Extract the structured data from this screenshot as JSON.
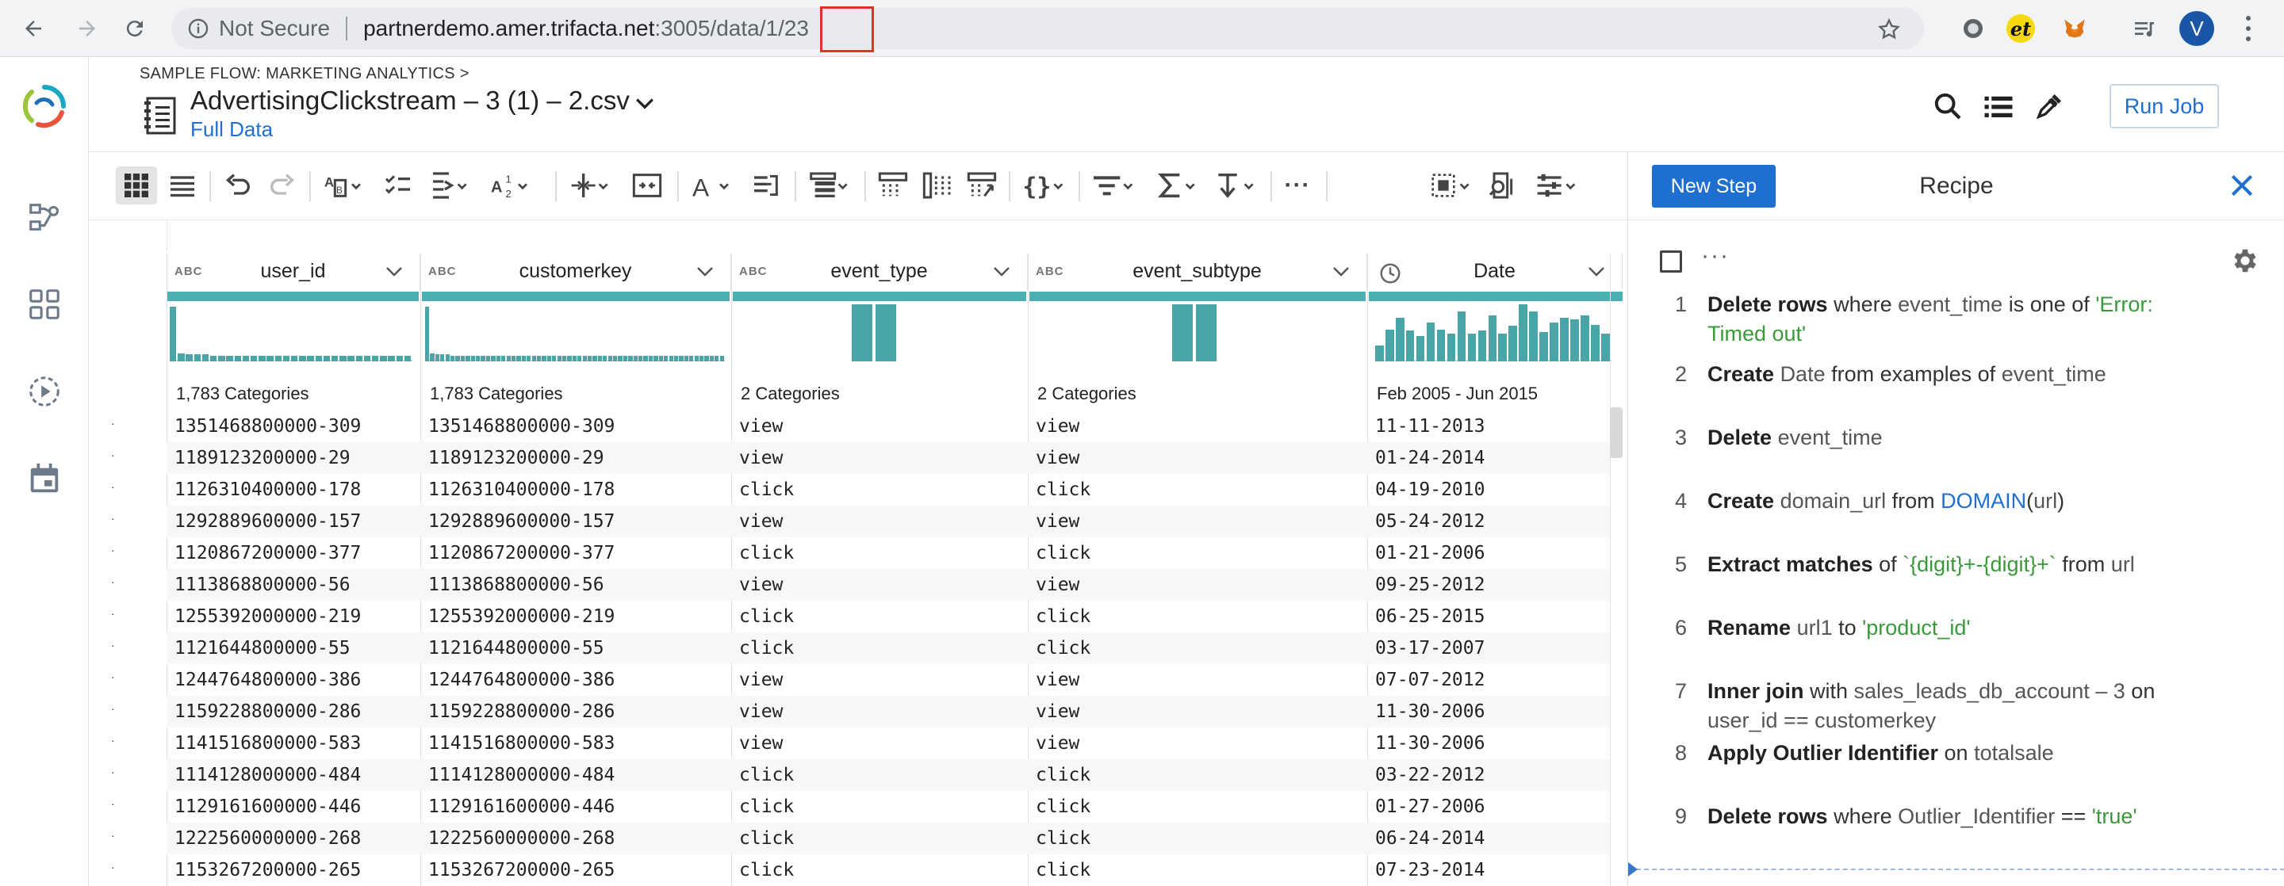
{
  "browser": {
    "not_secure": "Not Secure",
    "url_host": "partnerdemo.amer.trifacta.net",
    "url_rest": ":3005/data/1/",
    "url_highlight": "23",
    "avatar_letter": "V",
    "ext_letters": "et"
  },
  "header": {
    "breadcrumb": "SAMPLE FLOW: MARKETING ANALYTICS >",
    "title": "AdvertisingClickstream – 3 (1) – 2.csv",
    "subtitle": "Full Data",
    "run_job": "Run Job"
  },
  "grid": {
    "columns": [
      {
        "type": "ABC",
        "name": "user_id",
        "summary": "1,783 Categories"
      },
      {
        "type": "ABC",
        "name": "customerkey",
        "summary": "1,783 Categories"
      },
      {
        "type": "ABC",
        "name": "event_type",
        "summary": "2 Categories"
      },
      {
        "type": "ABC",
        "name": "event_subtype",
        "summary": "2 Categories"
      },
      {
        "type": "clock-icon",
        "name": "Date",
        "summary": "Feb 2005 - Jun 2015"
      }
    ],
    "histograms": {
      "user_id": [
        48,
        7,
        6,
        6,
        6,
        5,
        5,
        5,
        5,
        5,
        5,
        5,
        5,
        5,
        5,
        5,
        5,
        5,
        5,
        5,
        5,
        5,
        5,
        5,
        5,
        5,
        5,
        5,
        5,
        5
      ],
      "customerkey": [
        48,
        7,
        6,
        6,
        6,
        5,
        5,
        5,
        5,
        5,
        5,
        5,
        5,
        5,
        5,
        5,
        5,
        5,
        5,
        5,
        5,
        5,
        5,
        5,
        5,
        5,
        5,
        5,
        5,
        5,
        5,
        5,
        5,
        5,
        5,
        5,
        5,
        5,
        5,
        5,
        5,
        5,
        5,
        5,
        5,
        5,
        5,
        5,
        5,
        5,
        5,
        5,
        5,
        5,
        5,
        5,
        5,
        5,
        5
      ],
      "event_type": [
        50,
        50
      ],
      "event_subtype": [
        50,
        50
      ],
      "Date": [
        14,
        28,
        38,
        27,
        22,
        34,
        28,
        24,
        44,
        24,
        27,
        40,
        24,
        31,
        50,
        44,
        26,
        34,
        38,
        37,
        40,
        32,
        24
      ]
    },
    "rows": [
      [
        "1351468800000-309",
        "1351468800000-309",
        "view",
        "view",
        "11-11-2013"
      ],
      [
        "1189123200000-29",
        "1189123200000-29",
        "view",
        "view",
        "01-24-2014"
      ],
      [
        "1126310400000-178",
        "1126310400000-178",
        "click",
        "click",
        "04-19-2010"
      ],
      [
        "1292889600000-157",
        "1292889600000-157",
        "view",
        "view",
        "05-24-2012"
      ],
      [
        "1120867200000-377",
        "1120867200000-377",
        "click",
        "click",
        "01-21-2006"
      ],
      [
        "1113868800000-56",
        "1113868800000-56",
        "view",
        "view",
        "09-25-2012"
      ],
      [
        "1255392000000-219",
        "1255392000000-219",
        "click",
        "click",
        "06-25-2015"
      ],
      [
        "1121644800000-55",
        "1121644800000-55",
        "click",
        "click",
        "03-17-2007"
      ],
      [
        "1244764800000-386",
        "1244764800000-386",
        "view",
        "view",
        "07-07-2012"
      ],
      [
        "1159228800000-286",
        "1159228800000-286",
        "view",
        "view",
        "11-30-2006"
      ],
      [
        "1141516800000-583",
        "1141516800000-583",
        "view",
        "view",
        "11-30-2006"
      ],
      [
        "1114128000000-484",
        "1114128000000-484",
        "click",
        "click",
        "03-22-2012"
      ],
      [
        "1129161600000-446",
        "1129161600000-446",
        "click",
        "click",
        "01-27-2006"
      ],
      [
        "1222560000000-268",
        "1222560000000-268",
        "click",
        "click",
        "06-24-2014"
      ],
      [
        "1153267200000-265",
        "1153267200000-265",
        "click",
        "click",
        "07-23-2014"
      ]
    ],
    "row_marker": "·"
  },
  "recipe": {
    "new_step": "New Step",
    "title": "Recipe",
    "more": "···",
    "steps": [
      {
        "num": "1",
        "parts": [
          [
            "b",
            "Delete rows"
          ],
          [
            "t",
            " where "
          ],
          [
            "h",
            "event_time"
          ],
          [
            "t",
            " is one of "
          ],
          [
            "s",
            "'Error: Timed out'"
          ]
        ]
      },
      {
        "num": "2",
        "parts": [
          [
            "b",
            "Create"
          ],
          [
            "t",
            " "
          ],
          [
            "h",
            "Date"
          ],
          [
            "t",
            " from examples of "
          ],
          [
            "h",
            "event_time"
          ]
        ]
      },
      {
        "num": "3",
        "parts": [
          [
            "b",
            "Delete"
          ],
          [
            "t",
            " "
          ],
          [
            "h",
            "event_time"
          ]
        ]
      },
      {
        "num": "4",
        "parts": [
          [
            "b",
            "Create"
          ],
          [
            "t",
            " "
          ],
          [
            "h",
            "domain_url"
          ],
          [
            "t",
            " from "
          ],
          [
            "f",
            "DOMAIN"
          ],
          [
            "t",
            "("
          ],
          [
            "h",
            "url"
          ],
          [
            "t",
            ")"
          ]
        ]
      },
      {
        "num": "5",
        "parts": [
          [
            "b",
            "Extract matches"
          ],
          [
            "t",
            " of "
          ],
          [
            "s",
            "`{digit}+-{digit}+`"
          ],
          [
            "t",
            " from "
          ],
          [
            "h",
            "url"
          ]
        ]
      },
      {
        "num": "6",
        "parts": [
          [
            "b",
            "Rename"
          ],
          [
            "t",
            " "
          ],
          [
            "h",
            "url1"
          ],
          [
            "t",
            " to "
          ],
          [
            "s",
            "'product_id'"
          ]
        ]
      },
      {
        "num": "7",
        "parts": [
          [
            "b",
            "Inner join"
          ],
          [
            "t",
            " with "
          ],
          [
            "h",
            "sales_leads_db_account – 3"
          ],
          [
            "t",
            " on "
          ],
          [
            "h",
            "user_id == customerkey"
          ]
        ]
      },
      {
        "num": "8",
        "parts": [
          [
            "b",
            "Apply Outlier Identifier"
          ],
          [
            "t",
            " on "
          ],
          [
            "h",
            "totalsale"
          ]
        ]
      },
      {
        "num": "9",
        "parts": [
          [
            "b",
            "Delete rows"
          ],
          [
            "t",
            " where "
          ],
          [
            "h",
            "Outlier_Identifier"
          ],
          [
            "t",
            " == "
          ],
          [
            "s",
            "'true'"
          ]
        ]
      }
    ]
  },
  "colors": {
    "accent": "#1f6fd1",
    "teal": "#4aa5a8",
    "string": "#3a9a3a",
    "highlight_box": "#e0332a"
  }
}
